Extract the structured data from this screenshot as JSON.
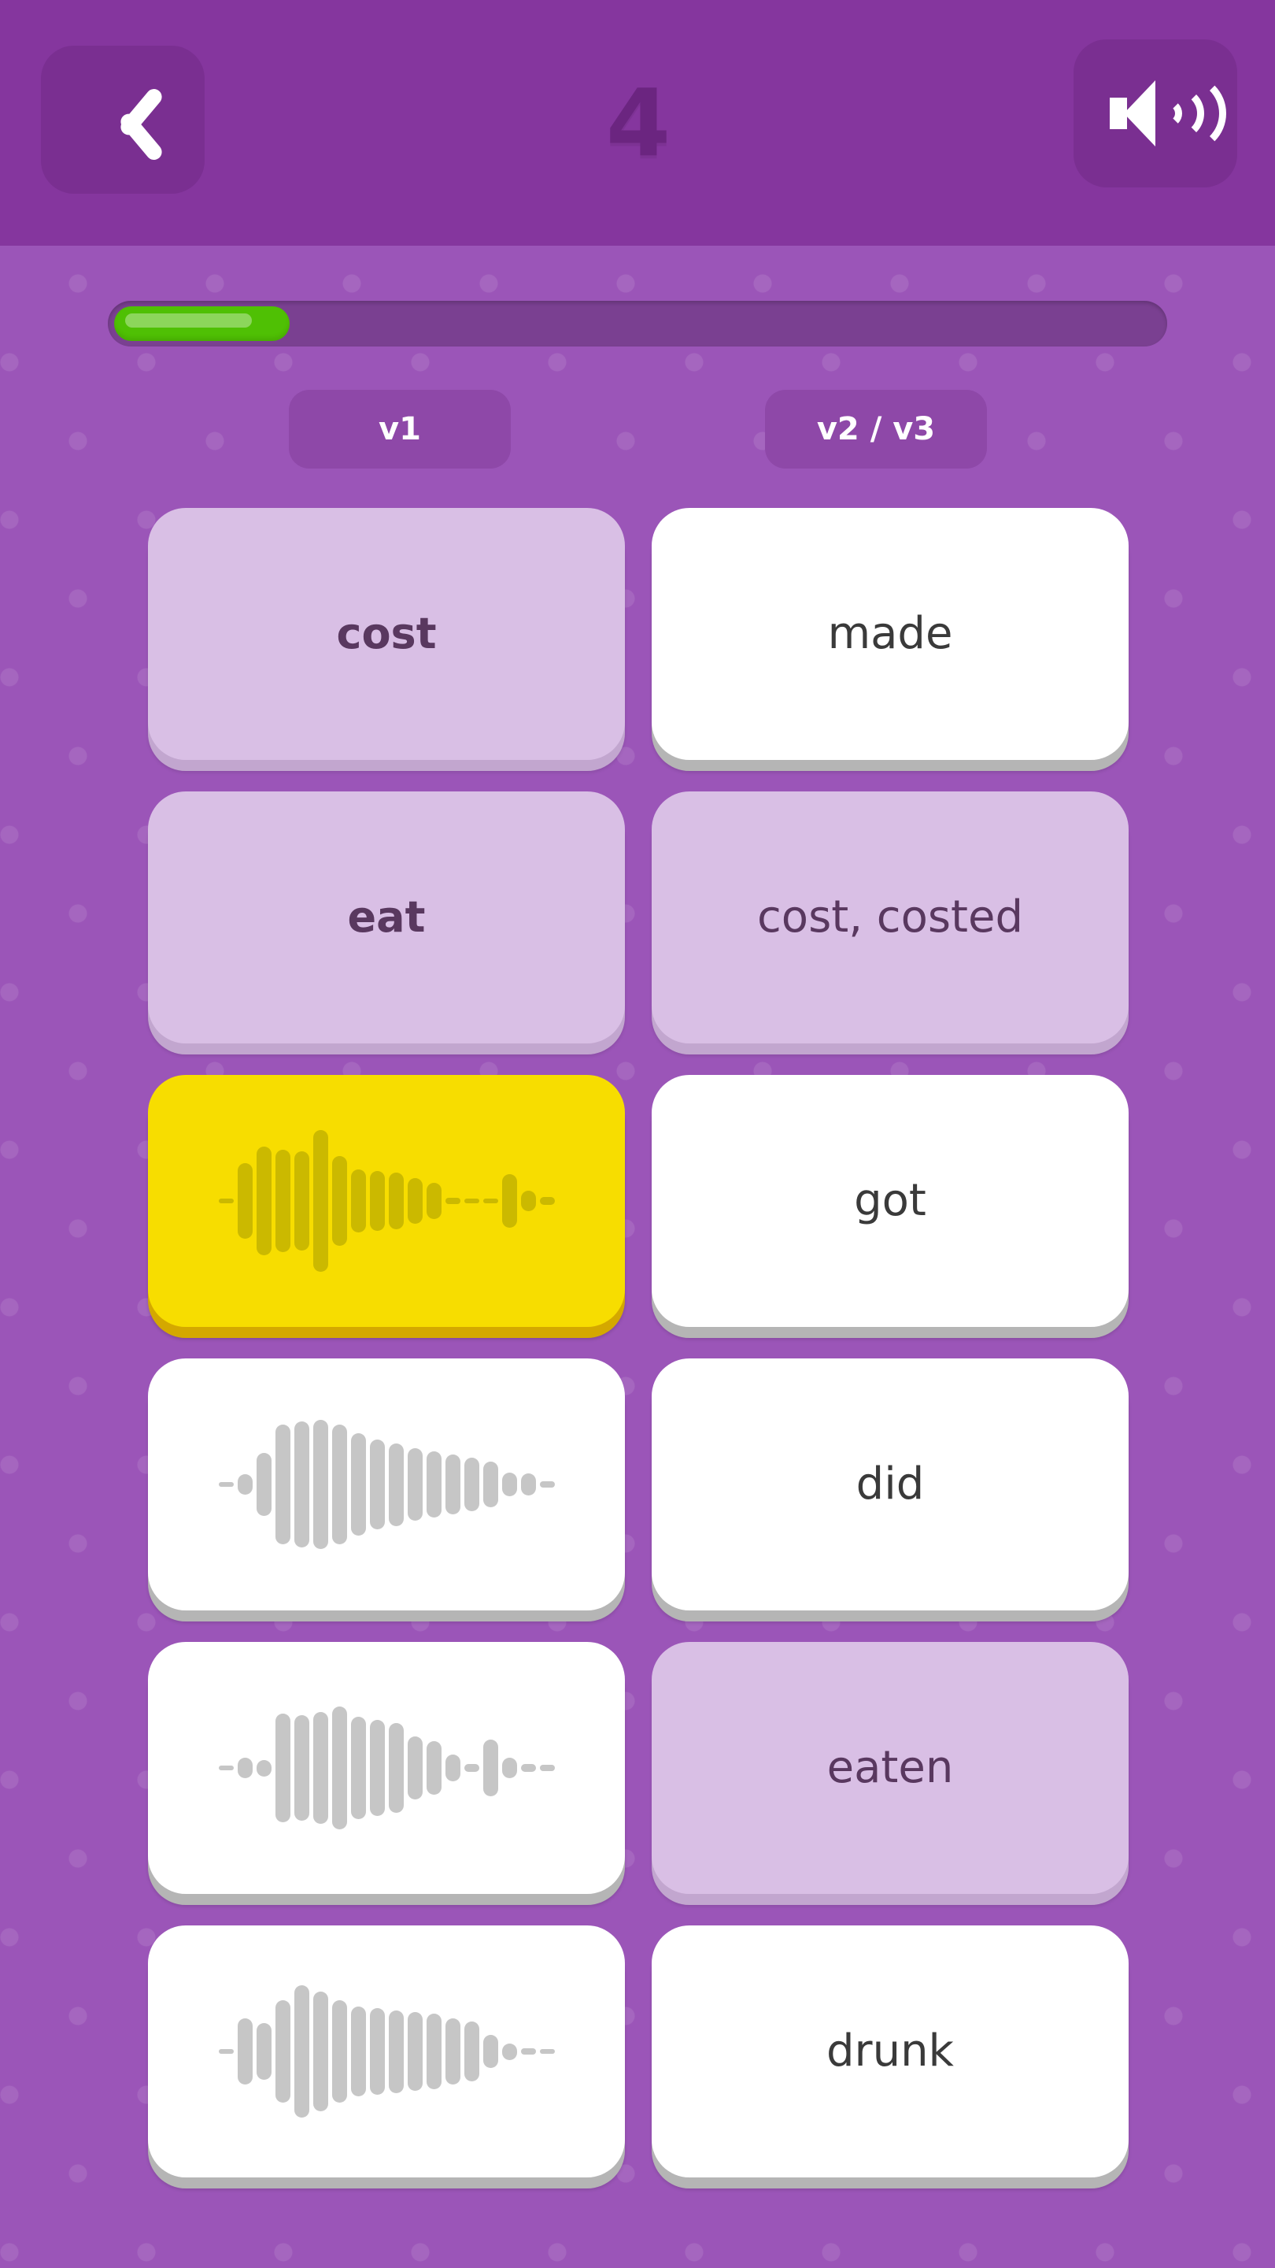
{
  "header": {
    "title": "4",
    "back_icon": "chevron-left-icon",
    "sound_icon": "speaker-icon",
    "bar_color": "#85369e",
    "button_color": "#7a2f91",
    "title_color": "#6b2580"
  },
  "progress": {
    "percent": 16.6,
    "fill_color": "#4fc004",
    "track_color": "#7a4091"
  },
  "columns": {
    "left_label": "v1",
    "right_label": "v2 / v3"
  },
  "theme": {
    "background": "#9b55b8",
    "card_white": "#ffffff",
    "card_matched": "#d9bfe5",
    "card_selected": "#f7dd00",
    "matched_text": "#59385f",
    "white_text": "#3a3a3a"
  },
  "rows": [
    {
      "left": {
        "type": "text",
        "label": "cost",
        "state": "matched",
        "weight": "bold"
      },
      "right": {
        "type": "text",
        "label": "made",
        "state": "white"
      }
    },
    {
      "left": {
        "type": "text",
        "label": "eat",
        "state": "matched",
        "weight": "bold"
      },
      "right": {
        "type": "text",
        "label": "cost, costed",
        "state": "matched",
        "weight": "regular"
      }
    },
    {
      "left": {
        "type": "waveform",
        "label": "audio-waveform",
        "state": "selected",
        "bars": [
          3,
          46,
          66,
          62,
          60,
          86,
          54,
          38,
          36,
          34,
          28,
          22,
          4,
          3,
          3,
          32,
          12,
          5
        ]
      },
      "right": {
        "type": "text",
        "label": "got",
        "state": "white"
      }
    },
    {
      "left": {
        "type": "waveform",
        "label": "audio-waveform",
        "state": "white",
        "bars": [
          3,
          12,
          38,
          72,
          76,
          78,
          72,
          62,
          54,
          50,
          44,
          40,
          36,
          32,
          28,
          14,
          13,
          4
        ]
      },
      "right": {
        "type": "text",
        "label": "did",
        "state": "white"
      }
    },
    {
      "left": {
        "type": "waveform",
        "label": "audio-waveform",
        "state": "white",
        "bars": [
          3,
          12,
          10,
          66,
          64,
          68,
          74,
          62,
          58,
          54,
          38,
          32,
          16,
          5,
          34,
          12,
          5,
          4
        ]
      },
      "right": {
        "type": "text",
        "label": "eaten",
        "state": "matched",
        "weight": "regular"
      }
    },
    {
      "left": {
        "type": "waveform",
        "label": "audio-waveform",
        "state": "white",
        "bars": [
          3,
          40,
          34,
          62,
          80,
          72,
          62,
          54,
          52,
          50,
          48,
          46,
          40,
          36,
          20,
          10,
          4,
          3
        ]
      },
      "right": {
        "type": "text",
        "label": "drunk",
        "state": "white"
      }
    }
  ]
}
